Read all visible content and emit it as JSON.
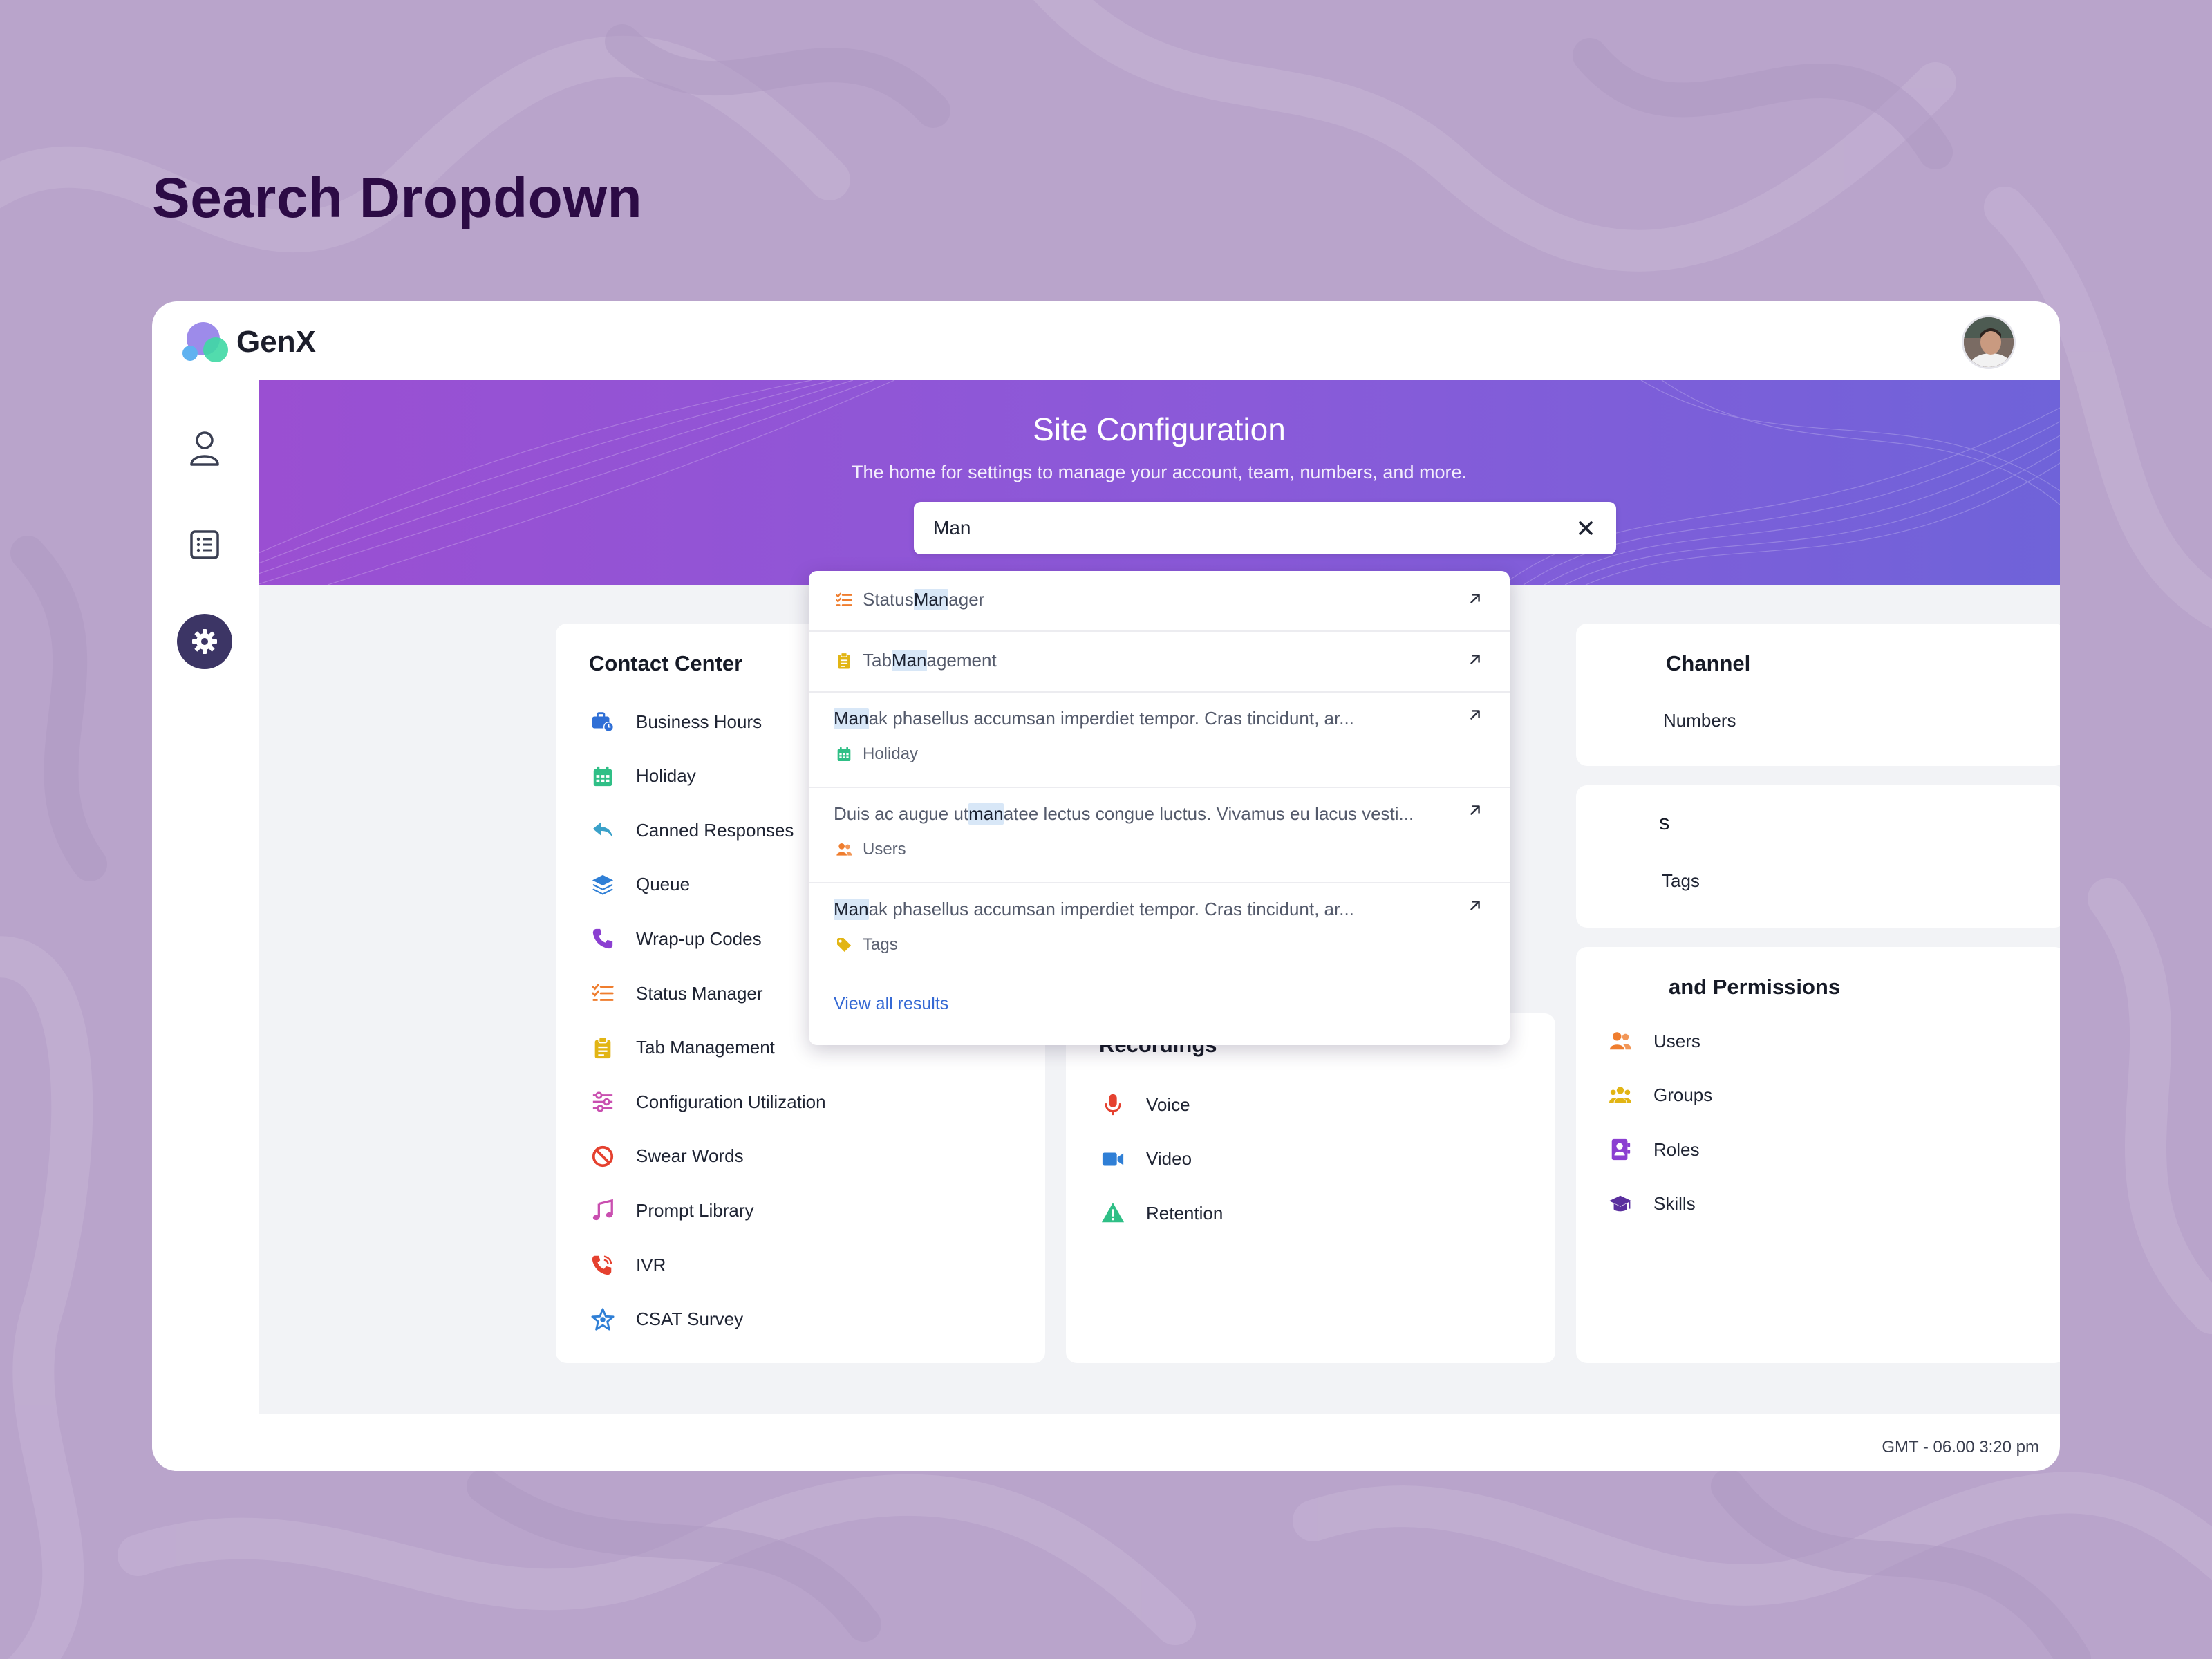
{
  "page": {
    "heading": "Search Dropdown"
  },
  "app": {
    "brand": "GenX"
  },
  "hero": {
    "title": "Site Configuration",
    "subtitle": "The home for settings to manage your account, team, numbers, and more.",
    "search_value": "Man"
  },
  "search_results": [
    {
      "pre": "Status ",
      "match": "Man",
      "post": "ager",
      "icon": "status-list-icon",
      "category": "",
      "category_icon": ""
    },
    {
      "pre": "Tab ",
      "match": "Man",
      "post": "agement",
      "icon": "clipboard-icon",
      "category": "",
      "category_icon": ""
    },
    {
      "pre": "",
      "match": "Man",
      "post": "ak phasellus accumsan imperdiet tempor. Cras tincidunt, ar...",
      "icon": "",
      "category": "Holiday",
      "category_icon": "calendar-icon"
    },
    {
      "pre": "Duis ac augue ut ",
      "match": "man",
      "post": "atee lectus congue luctus. Vivamus eu lacus vesti...",
      "icon": "",
      "category": "Users",
      "category_icon": "users-icon"
    },
    {
      "pre": "",
      "match": "Man",
      "post": "ak phasellus accumsan imperdiet tempor. Cras tincidunt, ar...",
      "icon": "",
      "category": "Tags",
      "category_icon": "tag-icon"
    }
  ],
  "view_all_label": "View all results",
  "cards": {
    "contact_center": {
      "title": "Contact Center",
      "items": [
        {
          "label": "Business Hours",
          "icon": "briefcase-clock-icon",
          "color": "#2f6fd6"
        },
        {
          "label": "Holiday",
          "icon": "calendar-icon",
          "color": "#2fbf86"
        },
        {
          "label": "Canned Responses",
          "icon": "reply-icon",
          "color": "#3aa1c9"
        },
        {
          "label": "Queue",
          "icon": "layers-icon",
          "color": "#2f7fd6"
        },
        {
          "label": "Wrap-up Codes",
          "icon": "phone-icon",
          "color": "#8b3fd1"
        },
        {
          "label": "Status Manager",
          "icon": "status-list-icon",
          "color": "#ef7d2e"
        },
        {
          "label": "Tab Management",
          "icon": "clipboard-icon",
          "color": "#e2b514"
        },
        {
          "label": "Configuration Utilization",
          "icon": "sliders-icon",
          "color": "#c94fb0"
        },
        {
          "label": "Swear Words",
          "icon": "ban-icon",
          "color": "#e5412f"
        },
        {
          "label": "Prompt Library",
          "icon": "music-icon",
          "color": "#c94fb0"
        },
        {
          "label": "IVR",
          "icon": "phone-volume-icon",
          "color": "#e5412f"
        },
        {
          "label": "CSAT Survey",
          "icon": "star-icon",
          "color": "#2f7fd6"
        }
      ]
    },
    "recordings": {
      "title": "Recordings",
      "items": [
        {
          "label": "Voice",
          "icon": "microphone-icon",
          "color": "#e5412f"
        },
        {
          "label": "Video",
          "icon": "video-camera-icon",
          "color": "#2f7fd6"
        },
        {
          "label": "Retention",
          "icon": "warning-icon",
          "color": "#2fbf86"
        }
      ]
    },
    "channel": {
      "title_visible": "Channel",
      "items": [
        {
          "label_visible": "Numbers"
        }
      ]
    },
    "tags_card": {
      "title_visible": "s",
      "items": [
        {
          "label_visible": "Tags"
        }
      ]
    },
    "permissions": {
      "title_visible": "and Permissions",
      "items": [
        {
          "label": "Users",
          "icon": "users-icon",
          "color": "#ef7d2e"
        },
        {
          "label": "Groups",
          "icon": "group-icon",
          "color": "#e2b514"
        },
        {
          "label": "Roles",
          "icon": "id-badge-icon",
          "color": "#8b3fd1"
        },
        {
          "label": "Skills",
          "icon": "graduation-cap-icon",
          "color": "#5a2f9e"
        }
      ]
    }
  },
  "footer": {
    "time": "GMT - 06.00 3:20 pm"
  },
  "colors": {
    "page_bg": "#b9a4cb",
    "heading": "#2c0b45",
    "hero_start": "#9a4fd2",
    "hero_end": "#6f63d9",
    "active_rail": "#3c3565",
    "link": "#3569d4",
    "match_highlight": "#d8e7f7"
  }
}
